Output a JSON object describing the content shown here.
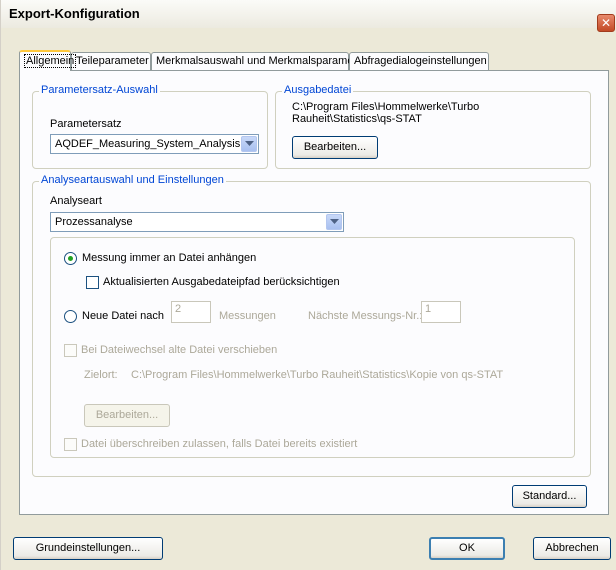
{
  "window": {
    "title": "Export-Konfiguration",
    "close_glyph": "✕"
  },
  "tabs": [
    {
      "label": "Allgemein"
    },
    {
      "label": "Teileparameter"
    },
    {
      "label": "Merkmalsauswahl und Merkmalsparameter"
    },
    {
      "label": "Abfragedialogeinstellungen"
    }
  ],
  "paramset": {
    "group_title": "Parametersatz-Auswahl",
    "label": "Parametersatz",
    "selected": "AQDEF_Measuring_System_Analysis"
  },
  "output": {
    "group_title": "Ausgabedatei",
    "path_line1": "C:\\Program Files\\Hommelwerke\\Turbo",
    "path_line2": "Rauheit\\Statistics\\qs-STAT",
    "edit_button": "Bearbeiten..."
  },
  "analysis": {
    "group_title": "Analyseartauswahl und Einstellungen",
    "type_label": "Analyseart",
    "type_selected": "Prozessanalyse",
    "append_radio": "Messung immer an Datei anhängen",
    "update_path_check": "Aktualisierten Ausgabedateipfad berücksichtigen",
    "new_file_radio": "Neue Datei nach",
    "measurements_value": "2",
    "measurements_label": "Messungen",
    "next_no_label": "Nächste Messungs-Nr.:",
    "next_no_value": "1",
    "move_old_check": "Bei Dateiwechsel alte Datei verschieben",
    "target_label": "Zielort:",
    "target_path": "C:\\Program Files\\Hommelwerke\\Turbo Rauheit\\Statistics\\Kopie von qs-STAT",
    "edit_button": "Bearbeiten...",
    "overwrite_check": "Datei überschreiben zulassen, falls Datei bereits existiert"
  },
  "footer": {
    "standard_button": "Standard...",
    "basic_settings_button": "Grundeinstellungen...",
    "ok_button": "OK",
    "cancel_button": "Abbrechen"
  },
  "state": {
    "append_selected": true,
    "new_file_selected": false
  }
}
